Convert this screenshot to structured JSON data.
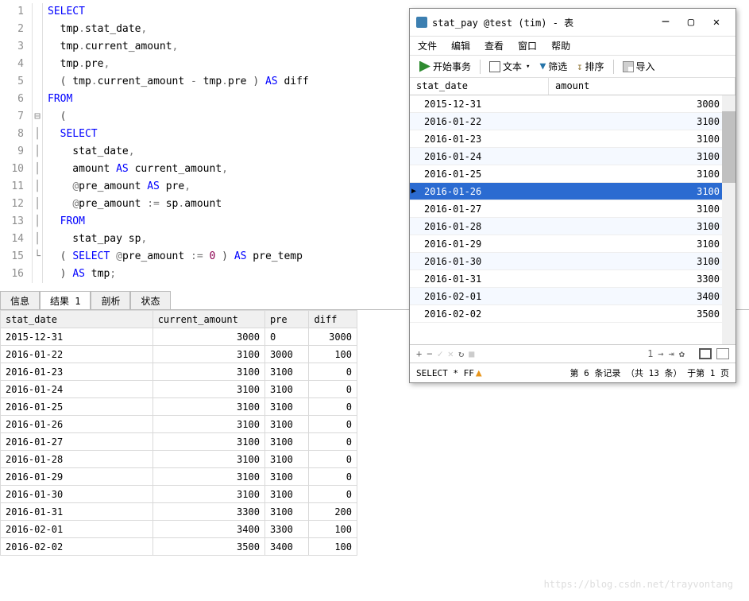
{
  "editor": {
    "lines": [
      {
        "n": "1",
        "fold": "",
        "tokens": [
          [
            "kw",
            "SELECT"
          ]
        ]
      },
      {
        "n": "2",
        "fold": "",
        "tokens": [
          [
            "",
            "  tmp"
          ],
          [
            "sym",
            "."
          ],
          [
            "",
            "stat_date"
          ],
          [
            "sym",
            ","
          ]
        ]
      },
      {
        "n": "3",
        "fold": "",
        "tokens": [
          [
            "",
            "  tmp"
          ],
          [
            "sym",
            "."
          ],
          [
            "",
            "current_amount"
          ],
          [
            "sym",
            ","
          ]
        ]
      },
      {
        "n": "4",
        "fold": "",
        "tokens": [
          [
            "",
            "  tmp"
          ],
          [
            "sym",
            "."
          ],
          [
            "",
            "pre"
          ],
          [
            "sym",
            ","
          ]
        ]
      },
      {
        "n": "5",
        "fold": "",
        "tokens": [
          [
            "",
            "  "
          ],
          [
            "paren",
            "("
          ],
          [
            "",
            " tmp"
          ],
          [
            "sym",
            "."
          ],
          [
            "",
            "current_amount "
          ],
          [
            "op",
            "-"
          ],
          [
            "",
            " tmp"
          ],
          [
            "sym",
            "."
          ],
          [
            "",
            "pre "
          ],
          [
            "paren",
            ")"
          ],
          [
            "",
            " "
          ],
          [
            "kw",
            "AS"
          ],
          [
            "",
            " diff"
          ]
        ]
      },
      {
        "n": "6",
        "fold": "",
        "tokens": [
          [
            "kw",
            "FROM"
          ]
        ]
      },
      {
        "n": "7",
        "fold": "⊟",
        "tokens": [
          [
            "",
            "  "
          ],
          [
            "paren",
            "("
          ]
        ]
      },
      {
        "n": "8",
        "fold": "│",
        "tokens": [
          [
            "",
            "  "
          ],
          [
            "kw",
            "SELECT"
          ]
        ]
      },
      {
        "n": "9",
        "fold": "│",
        "tokens": [
          [
            "",
            "    stat_date"
          ],
          [
            "sym",
            ","
          ]
        ]
      },
      {
        "n": "10",
        "fold": "│",
        "tokens": [
          [
            "",
            "    amount "
          ],
          [
            "kw",
            "AS"
          ],
          [
            "",
            " current_amount"
          ],
          [
            "sym",
            ","
          ]
        ]
      },
      {
        "n": "11",
        "fold": "│",
        "tokens": [
          [
            "",
            "    "
          ],
          [
            "sym",
            "@"
          ],
          [
            "",
            "pre_amount "
          ],
          [
            "kw",
            "AS"
          ],
          [
            "",
            " pre"
          ],
          [
            "sym",
            ","
          ]
        ]
      },
      {
        "n": "12",
        "fold": "│",
        "tokens": [
          [
            "",
            "    "
          ],
          [
            "sym",
            "@"
          ],
          [
            "",
            "pre_amount "
          ],
          [
            "op",
            ":="
          ],
          [
            "",
            " sp"
          ],
          [
            "sym",
            "."
          ],
          [
            "",
            "amount"
          ]
        ]
      },
      {
        "n": "13",
        "fold": "│",
        "tokens": [
          [
            "",
            "  "
          ],
          [
            "kw",
            "FROM"
          ]
        ]
      },
      {
        "n": "14",
        "fold": "│",
        "tokens": [
          [
            "",
            "    stat_pay sp"
          ],
          [
            "sym",
            ","
          ]
        ]
      },
      {
        "n": "15",
        "fold": "└",
        "tokens": [
          [
            "",
            "  "
          ],
          [
            "paren",
            "("
          ],
          [
            "",
            " "
          ],
          [
            "kw",
            "SELECT"
          ],
          [
            "",
            " "
          ],
          [
            "sym",
            "@"
          ],
          [
            "",
            "pre_amount "
          ],
          [
            "op",
            ":="
          ],
          [
            "",
            " "
          ],
          [
            "num",
            "0"
          ],
          [
            "",
            " "
          ],
          [
            "paren",
            ")"
          ],
          [
            "",
            " "
          ],
          [
            "kw",
            "AS"
          ],
          [
            "",
            " pre_temp"
          ]
        ]
      },
      {
        "n": "16",
        "fold": "",
        "tokens": [
          [
            "",
            "  "
          ],
          [
            "paren",
            ")"
          ],
          [
            "",
            " "
          ],
          [
            "kw",
            "AS"
          ],
          [
            "",
            " tmp"
          ],
          [
            "sym",
            ";"
          ]
        ]
      }
    ]
  },
  "tabs": {
    "t0": "信息",
    "t1": "结果 1",
    "t2": "剖析",
    "t3": "状态"
  },
  "result": {
    "headers": {
      "h0": "stat_date",
      "h1": "current_amount",
      "h2": "pre",
      "h3": "diff"
    },
    "rows": [
      {
        "d": "2015-12-31",
        "c": "3000",
        "p": "0",
        "f": "3000"
      },
      {
        "d": "2016-01-22",
        "c": "3100",
        "p": "3000",
        "f": "100"
      },
      {
        "d": "2016-01-23",
        "c": "3100",
        "p": "3100",
        "f": "0"
      },
      {
        "d": "2016-01-24",
        "c": "3100",
        "p": "3100",
        "f": "0"
      },
      {
        "d": "2016-01-25",
        "c": "3100",
        "p": "3100",
        "f": "0"
      },
      {
        "d": "2016-01-26",
        "c": "3100",
        "p": "3100",
        "f": "0"
      },
      {
        "d": "2016-01-27",
        "c": "3100",
        "p": "3100",
        "f": "0"
      },
      {
        "d": "2016-01-28",
        "c": "3100",
        "p": "3100",
        "f": "0"
      },
      {
        "d": "2016-01-29",
        "c": "3100",
        "p": "3100",
        "f": "0"
      },
      {
        "d": "2016-01-30",
        "c": "3100",
        "p": "3100",
        "f": "0"
      },
      {
        "d": "2016-01-31",
        "c": "3300",
        "p": "3100",
        "f": "200"
      },
      {
        "d": "2016-02-01",
        "c": "3400",
        "p": "3300",
        "f": "100"
      },
      {
        "d": "2016-02-02",
        "c": "3500",
        "p": "3400",
        "f": "100"
      }
    ]
  },
  "popup": {
    "title": "stat_pay @test (tim) - 表",
    "menu": {
      "file": "文件",
      "edit": "编辑",
      "view": "查看",
      "window": "窗口",
      "help": "帮助"
    },
    "toolbar": {
      "begin": "开始事务",
      "text": "文本",
      "filter": "筛选",
      "sort": "排序",
      "import": "导入"
    },
    "headers": {
      "h0": "stat_date",
      "h1": "amount"
    },
    "rows": [
      {
        "d": "2015-12-31",
        "a": "3000",
        "sel": false
      },
      {
        "d": "2016-01-22",
        "a": "3100",
        "sel": false
      },
      {
        "d": "2016-01-23",
        "a": "3100",
        "sel": false
      },
      {
        "d": "2016-01-24",
        "a": "3100",
        "sel": false
      },
      {
        "d": "2016-01-25",
        "a": "3100",
        "sel": false
      },
      {
        "d": "2016-01-26",
        "a": "3100",
        "sel": true
      },
      {
        "d": "2016-01-27",
        "a": "3100",
        "sel": false
      },
      {
        "d": "2016-01-28",
        "a": "3100",
        "sel": false
      },
      {
        "d": "2016-01-29",
        "a": "3100",
        "sel": false
      },
      {
        "d": "2016-01-30",
        "a": "3100",
        "sel": false
      },
      {
        "d": "2016-01-31",
        "a": "3300",
        "sel": false
      },
      {
        "d": "2016-02-01",
        "a": "3400",
        "sel": false
      },
      {
        "d": "2016-02-02",
        "a": "3500",
        "sel": false
      }
    ],
    "nav_page": "1",
    "status_sql": "SELECT * FF",
    "status_text": "第 6 条记录 （共 13 条） 于第 1 页"
  },
  "watermark": "https://blog.csdn.net/trayvontang"
}
